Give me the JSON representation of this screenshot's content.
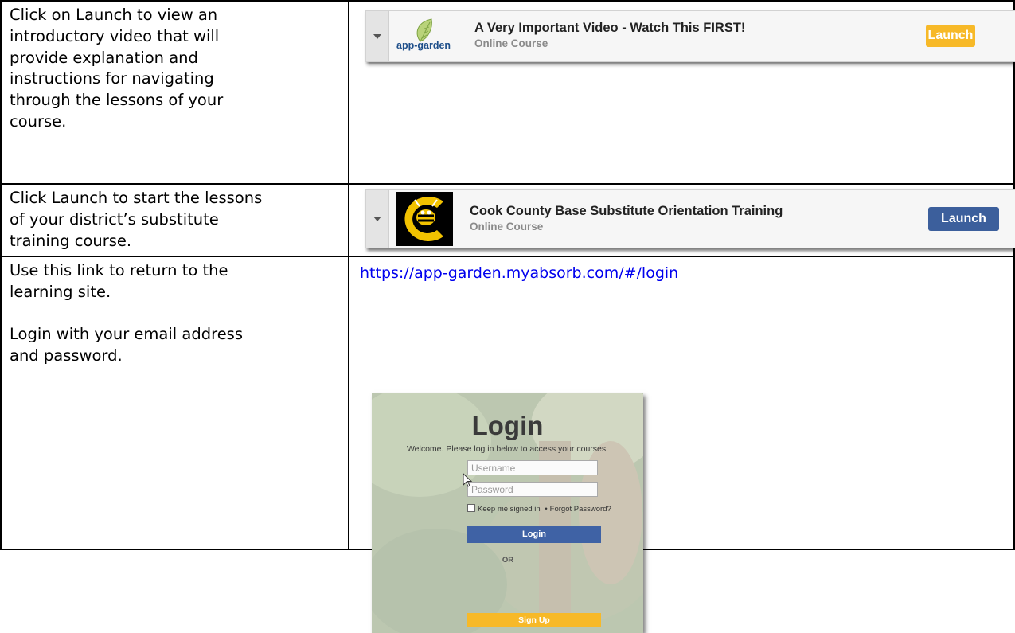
{
  "rows": [
    {
      "instruction": "Click on Launch to view an introductory video that will provide explanation and instructions for navigating through the lessons of your course.",
      "instruction_lines": [
        "Click on Launch to view an",
        "introductory video that will",
        "provide explanation and",
        "instructions for navigating",
        "through the lessons of your",
        "course."
      ],
      "card": {
        "logo_text": "app-garden",
        "title": "A Very Important Video - Watch This FIRST!",
        "subtitle": "Online Course",
        "button_label": "Launch",
        "button_color": "#f7b928"
      }
    },
    {
      "instruction_lines": [
        "Click Launch to start the lessons",
        "of your district’s substitute",
        "training course."
      ],
      "card": {
        "title": "Cook County Base Substitute Orientation Training",
        "subtitle": "Online Course",
        "button_label": "Launch",
        "button_color": "#3c5f9c"
      }
    },
    {
      "instruction_lines": [
        "Use this link to return to the",
        "learning site.",
        "",
        "Login with your email address",
        "and password."
      ],
      "link": "https://app-garden.myabsorb.com/#/login",
      "login": {
        "heading": "Login",
        "welcome": "Welcome. Please log in below to access your courses.",
        "username_placeholder": "Username",
        "password_placeholder": "Password",
        "keep_signed_in": "Keep me signed in",
        "separator": "•",
        "forgot_password": "Forgot Password?",
        "login_button": "Login",
        "or": "OR",
        "signup_button": "Sign Up"
      }
    }
  ],
  "colors": {
    "login_blue": "#3f62a5",
    "signup_yellow": "#f7b928",
    "link_blue": "#0000ee"
  },
  "icons": [
    "chevron-down-icon",
    "app-garden-logo",
    "yellow-jacket-logo",
    "mouse-cursor-icon"
  ]
}
